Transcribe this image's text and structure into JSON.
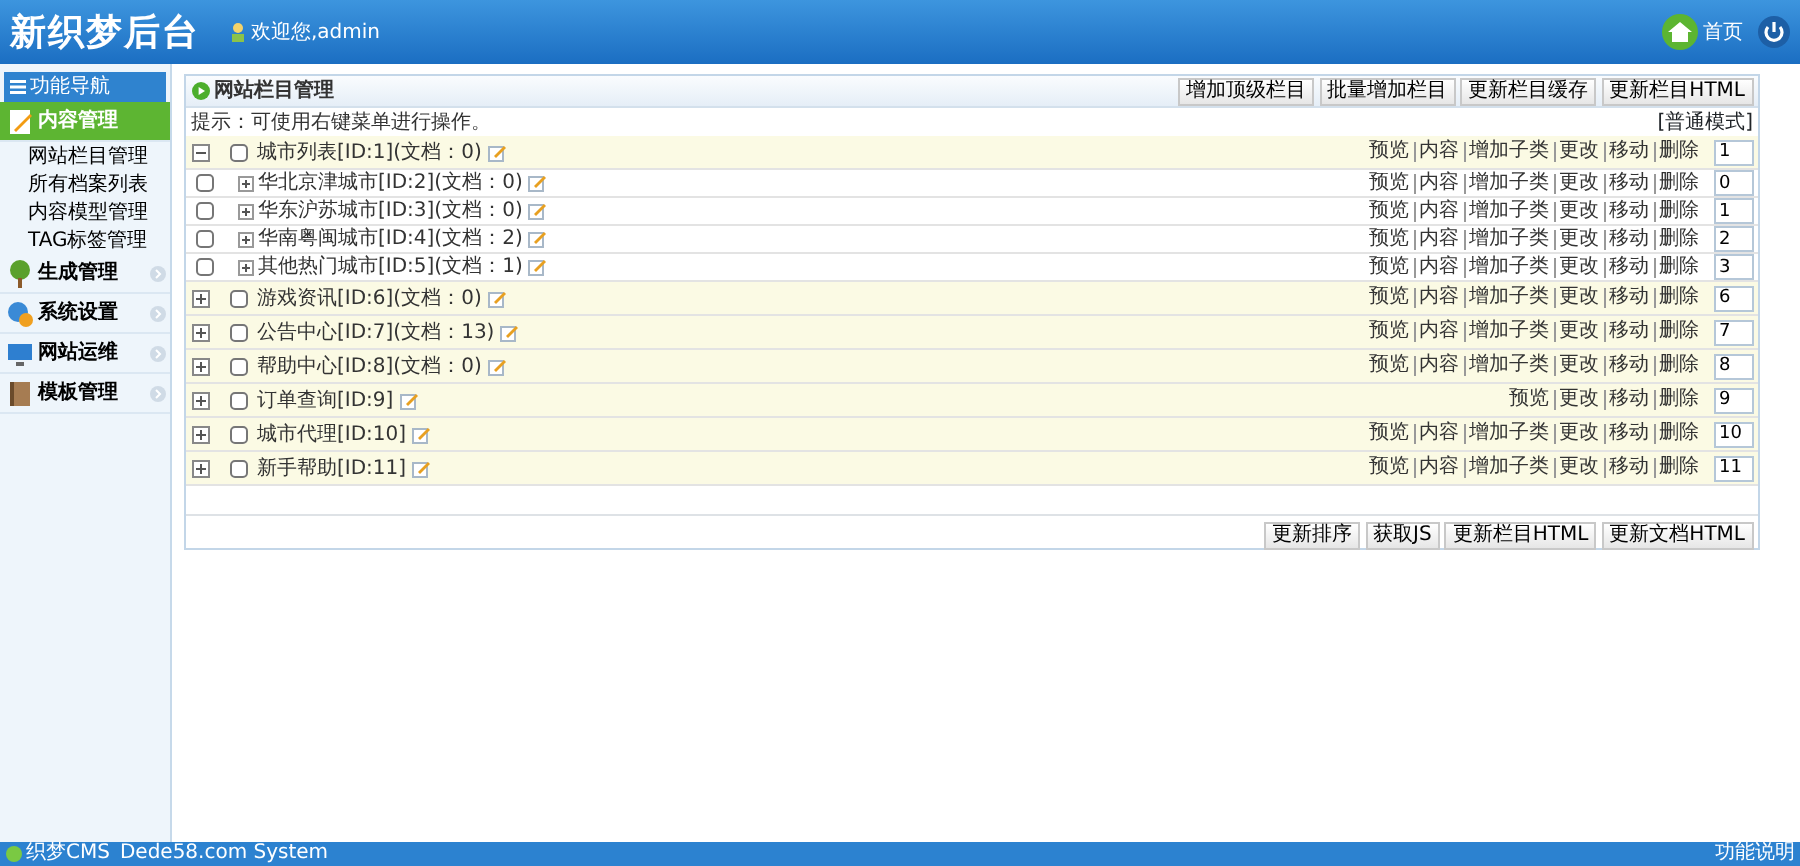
{
  "header": {
    "logo": "新织梦后台",
    "welcome": "欢迎您,admin",
    "home": "首页"
  },
  "sidebar": {
    "title": "功能导航",
    "groups": [
      {
        "label": "内容管理",
        "selected": true,
        "expanded": true,
        "children": [
          "网站栏目管理",
          "所有档案列表",
          "内容模型管理",
          "TAG标签管理"
        ]
      },
      {
        "label": "生成管理",
        "selected": false,
        "expanded": false
      },
      {
        "label": "系统设置",
        "selected": false,
        "expanded": false
      },
      {
        "label": "网站运维",
        "selected": false,
        "expanded": false
      },
      {
        "label": "模板管理",
        "selected": false,
        "expanded": false
      }
    ]
  },
  "panel": {
    "title": "网站栏目管理",
    "toolbar": [
      "增加顶级栏目",
      "批量增加栏目",
      "更新栏目缓存",
      "更新栏目HTML"
    ],
    "tip": "提示：可使用右键菜单进行操作。",
    "mode": "[普通模式]",
    "rows": [
      {
        "title": "城市列表[ID:1](文档：0)",
        "expanded": true,
        "checked": false,
        "actions": [
          "预览",
          "内容",
          "增加子类",
          "更改",
          "移动",
          "删除"
        ],
        "order": "1",
        "children": [
          {
            "title": "华北京津城市[ID:2](文档：0)",
            "checked": false,
            "actions": [
              "预览",
              "内容",
              "增加子类",
              "更改",
              "移动",
              "删除"
            ],
            "order": "0"
          },
          {
            "title": "华东沪苏城市[ID:3](文档：0)",
            "checked": false,
            "actions": [
              "预览",
              "内容",
              "增加子类",
              "更改",
              "移动",
              "删除"
            ],
            "order": "1"
          },
          {
            "title": "华南粤闽城市[ID:4](文档：2)",
            "checked": false,
            "actions": [
              "预览",
              "内容",
              "增加子类",
              "更改",
              "移动",
              "删除"
            ],
            "order": "2"
          },
          {
            "title": "其他热门城市[ID:5](文档：1)",
            "checked": false,
            "actions": [
              "预览",
              "内容",
              "增加子类",
              "更改",
              "移动",
              "删除"
            ],
            "order": "3"
          }
        ]
      },
      {
        "title": "游戏资讯[ID:6](文档：0)",
        "expanded": false,
        "checked": false,
        "actions": [
          "预览",
          "内容",
          "增加子类",
          "更改",
          "移动",
          "删除"
        ],
        "order": "6"
      },
      {
        "title": "公告中心[ID:7](文档：13)",
        "expanded": false,
        "checked": false,
        "actions": [
          "预览",
          "内容",
          "增加子类",
          "更改",
          "移动",
          "删除"
        ],
        "order": "7"
      },
      {
        "title": "帮助中心[ID:8](文档：0)",
        "expanded": false,
        "checked": false,
        "actions": [
          "预览",
          "内容",
          "增加子类",
          "更改",
          "移动",
          "删除"
        ],
        "order": "8"
      },
      {
        "title": "订单查询[ID:9]",
        "expanded": false,
        "checked": false,
        "actions": [
          "预览",
          "更改",
          "移动",
          "删除"
        ],
        "order": "9"
      },
      {
        "title": "城市代理[ID:10]",
        "expanded": false,
        "checked": false,
        "actions": [
          "预览",
          "内容",
          "增加子类",
          "更改",
          "移动",
          "删除"
        ],
        "order": "10"
      },
      {
        "title": "新手帮助[ID:11]",
        "expanded": false,
        "checked": false,
        "actions": [
          "预览",
          "内容",
          "增加子类",
          "更改",
          "移动",
          "删除"
        ],
        "order": "11"
      }
    ],
    "footer_buttons": [
      "更新排序",
      "获取JS",
      "更新栏目HTML",
      "更新文档HTML"
    ]
  },
  "status_bar": {
    "brand": "织梦CMS",
    "system": "Dede58.com System",
    "right": "功能说明"
  }
}
